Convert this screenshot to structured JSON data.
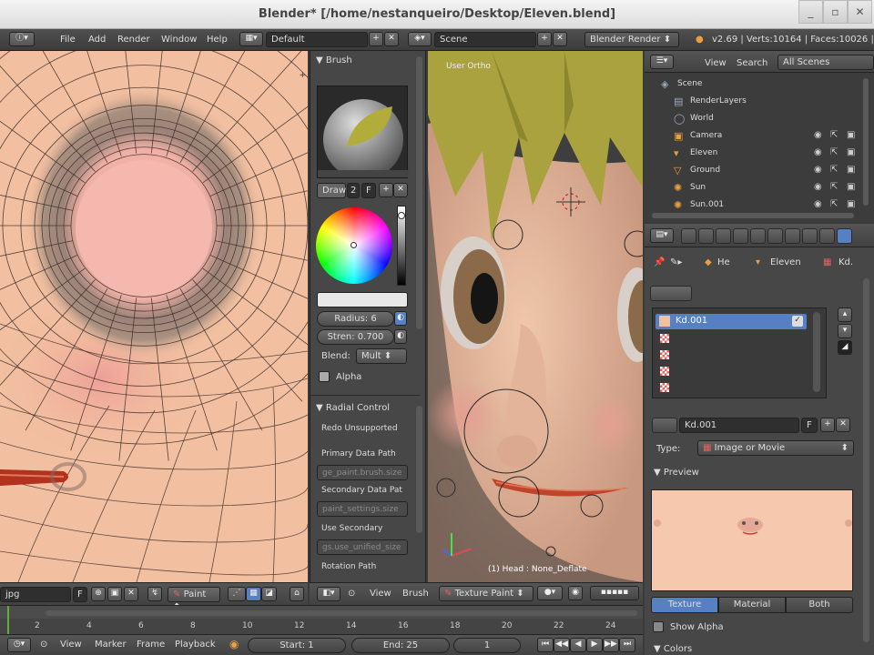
{
  "window": {
    "title": "Blender* [/home/nestanqueiro/Desktop/Eleven.blend]",
    "min": "_",
    "max": "▫",
    "close": "✕"
  },
  "menubar": {
    "items": [
      "File",
      "Add",
      "Render",
      "Window",
      "Help"
    ],
    "layout": "Default",
    "scene": "Scene",
    "engine": "Blender Render",
    "stats": "v2.69 | Verts:10164 | Faces:10026 |"
  },
  "brush": {
    "panel_title": "Brush",
    "mode": "Draw",
    "user_count": "2",
    "fake": "F",
    "radius": "Radius: 6",
    "strength": "Stren: 0.700",
    "blend_label": "Blend:",
    "blend_value": "Mult",
    "alpha_label": "Alpha"
  },
  "radial": {
    "title": "Radial Control",
    "redo": "Redo Unsupported",
    "primary_label": "Primary Data Path",
    "primary_value": "ge_paint.brush.size",
    "secondary_label": "Secondary Data Pat",
    "secondary_value": "paint_settings.size",
    "use_secondary_label": "Use Secondary",
    "use_secondary_value": "gs.use_unified_size",
    "rotation_label": "Rotation Path"
  },
  "viewport": {
    "view_label": "User Ortho",
    "status": "(1) Head : None_Deflate"
  },
  "outliner": {
    "view": "View",
    "search": "Search",
    "filter": "All Scenes",
    "rows": [
      "Scene",
      "RenderLayers",
      "World",
      "Camera",
      "Eleven",
      "Ground",
      "Sun",
      "Sun.001"
    ]
  },
  "properties": {
    "breadcrumb": [
      "He",
      "Eleven",
      "Kd."
    ],
    "slot_name": "Kd.001",
    "texture_name": "Kd.001",
    "fake": "F",
    "type_label": "Type:",
    "type_value": "Image or Movie",
    "preview_title": "Preview",
    "tabs": [
      "Texture",
      "Material",
      "Both"
    ],
    "show_alpha": "Show Alpha",
    "colors_title": "Colors"
  },
  "uv_header": {
    "image": "jpg",
    "fake": "F",
    "mode": "Paint"
  },
  "v3d_header": {
    "view": "View",
    "brush": "Brush",
    "mode": "Texture Paint"
  },
  "timeline": {
    "ticks": [
      "2",
      "4",
      "6",
      "8",
      "10",
      "12",
      "14",
      "16",
      "18",
      "20",
      "22",
      "24"
    ],
    "current_frame": "1",
    "start": "Start: 1",
    "end": "End: 25"
  },
  "timeline_header": {
    "items": [
      "View",
      "Marker",
      "Frame",
      "Playback"
    ]
  },
  "colors": {
    "accent": "#5680c2",
    "skin": "#f2bfa0",
    "lip": "#c0432c",
    "hair": "#a9a23e"
  }
}
